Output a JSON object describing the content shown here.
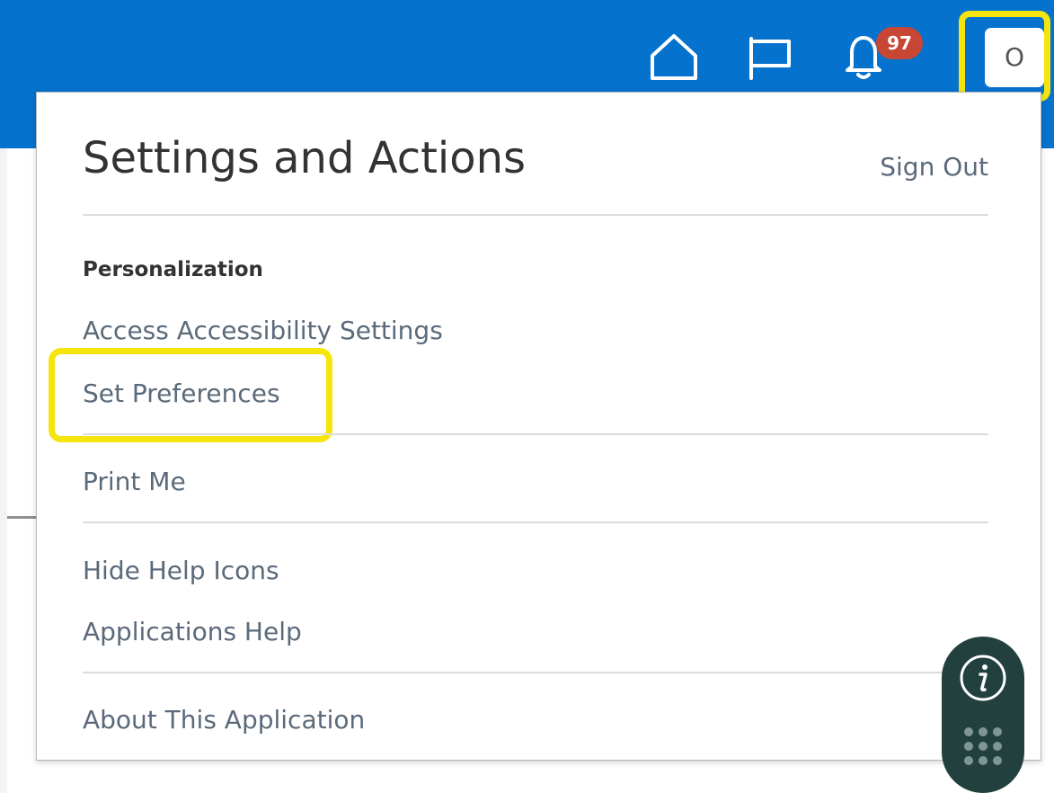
{
  "header": {
    "notification_count": "97",
    "avatar_initial": "O",
    "icons": [
      "home-icon",
      "flag-icon",
      "bell-icon"
    ],
    "brand_color": "#0572ce",
    "badge_color": "#c74634",
    "highlight_color": "#f5e50d"
  },
  "menu": {
    "title": "Settings and Actions",
    "sign_out": "Sign Out",
    "section_personalization": "Personalization",
    "items": {
      "accessibility": "Access Accessibility Settings",
      "preferences": "Set Preferences",
      "print_me": "Print Me",
      "hide_help": "Hide Help Icons",
      "apps_help": "Applications Help",
      "about": "About This Application"
    }
  },
  "help_widget": {
    "icons": [
      "info-icon",
      "apps-grid-icon"
    ],
    "color": "#22403e"
  }
}
